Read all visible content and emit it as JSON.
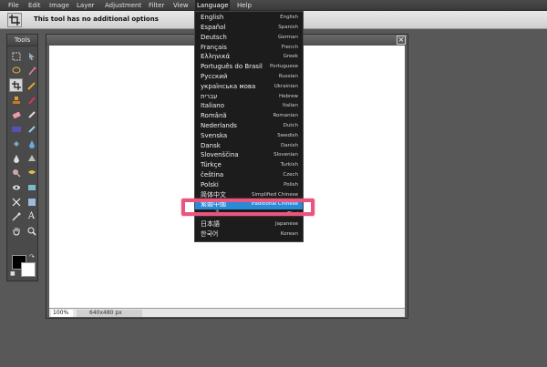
{
  "menubar": {
    "items": [
      "File",
      "Edit",
      "Image",
      "Layer",
      "Adjustment",
      "Filter",
      "View",
      "Language",
      "Help"
    ],
    "active": "Language"
  },
  "options_bar": {
    "tool_icon": "crop-icon",
    "text": "This tool has no additional options"
  },
  "tools_panel": {
    "title": "Tools",
    "tools": [
      "marquee-icon",
      "move-icon",
      "lasso-icon",
      "magic-wand-icon",
      "crop-icon",
      "pencil-icon",
      "stamp-icon",
      "brush-icon",
      "eraser-icon",
      "smudge-icon",
      "gradient-icon",
      "replace-color-icon",
      "bucket-icon",
      "blur-icon",
      "dropper-icon",
      "sharpen-icon",
      "burn-icon",
      "dodge-icon",
      "red-eye-icon",
      "sponge-icon",
      "pinch-icon",
      "bloat-icon",
      "color-picker-icon",
      "text-icon",
      "hand-icon",
      "zoom-icon"
    ],
    "selected_tool": "crop-icon",
    "foreground_color": "#000000",
    "background_color": "#ffffff"
  },
  "canvas_window": {
    "close_label": "×",
    "zoom": "100%",
    "size": "640x480 px"
  },
  "language_menu": {
    "items": [
      {
        "native": "English",
        "english": "English"
      },
      {
        "native": "Español",
        "english": "Spanish"
      },
      {
        "native": "Deutsch",
        "english": "German"
      },
      {
        "native": "Français",
        "english": "French"
      },
      {
        "native": "Ελληνικά",
        "english": "Greek"
      },
      {
        "native": "Português do Brasil",
        "english": "Portuguese"
      },
      {
        "native": "Русский",
        "english": "Russian"
      },
      {
        "native": "українська мова",
        "english": "Ukrainian"
      },
      {
        "native": "עברית",
        "english": "Hebrew"
      },
      {
        "native": "Italiano",
        "english": "Italian"
      },
      {
        "native": "Română",
        "english": "Romanian"
      },
      {
        "native": "Nederlands",
        "english": "Dutch"
      },
      {
        "native": "Svenska",
        "english": "Swedish"
      },
      {
        "native": "Dansk",
        "english": "Danish"
      },
      {
        "native": "Slovenščina",
        "english": "Slovenian"
      },
      {
        "native": "Türkçe",
        "english": "Turkish"
      },
      {
        "native": "čeština",
        "english": "Czech"
      },
      {
        "native": "Polski",
        "english": "Polish"
      },
      {
        "native": "简体中文",
        "english": "Simplified Chinese"
      },
      {
        "native": "繁體中國",
        "english": "Traditional Chinese"
      },
      {
        "native": "ภาษาไทย",
        "english": "Thai"
      },
      {
        "native": "日本語",
        "english": "Japanese"
      },
      {
        "native": "한국어",
        "english": "Korean"
      }
    ],
    "selected": "Traditional Chinese",
    "highlight_color": "#e8567e"
  }
}
